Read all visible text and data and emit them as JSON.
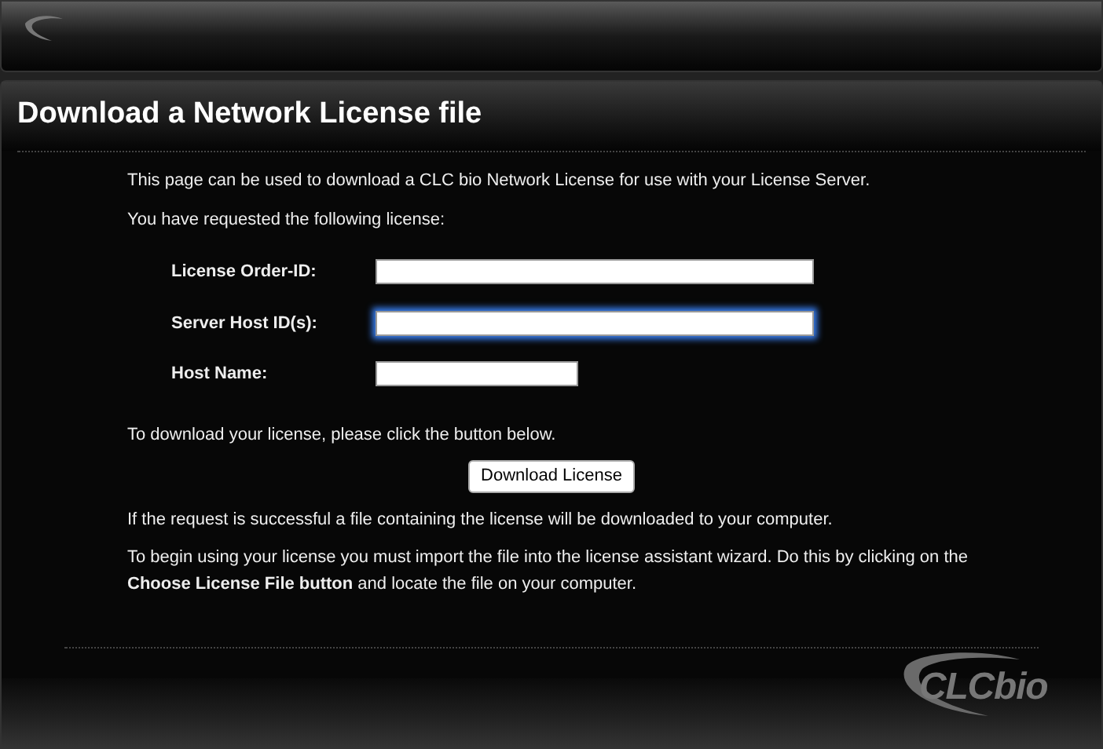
{
  "page": {
    "title": "Download a Network License file"
  },
  "intro": [
    "This page can be used to download a CLC bio Network License for use with your License Server.",
    "You have requested the following license:"
  ],
  "fields": [
    {
      "label": "License Order-ID:",
      "kind": "wide",
      "focused": false
    },
    {
      "label": "Server Host ID(s):",
      "kind": "wide",
      "focused": true
    },
    {
      "label": "Host Name:",
      "kind": "short",
      "focused": false
    }
  ],
  "download_prompt": "To download your license, please click the button below.",
  "download_button": "Download License",
  "notes": [
    "If the request is successful a file containing the license will be downloaded to your computer.",
    "To begin using your license you must import the file into the license assistant wizard. Do this by clicking on the **Choose License File button** and locate the file on your computer."
  ],
  "footer": {
    "logo_text": "CLCbio"
  }
}
